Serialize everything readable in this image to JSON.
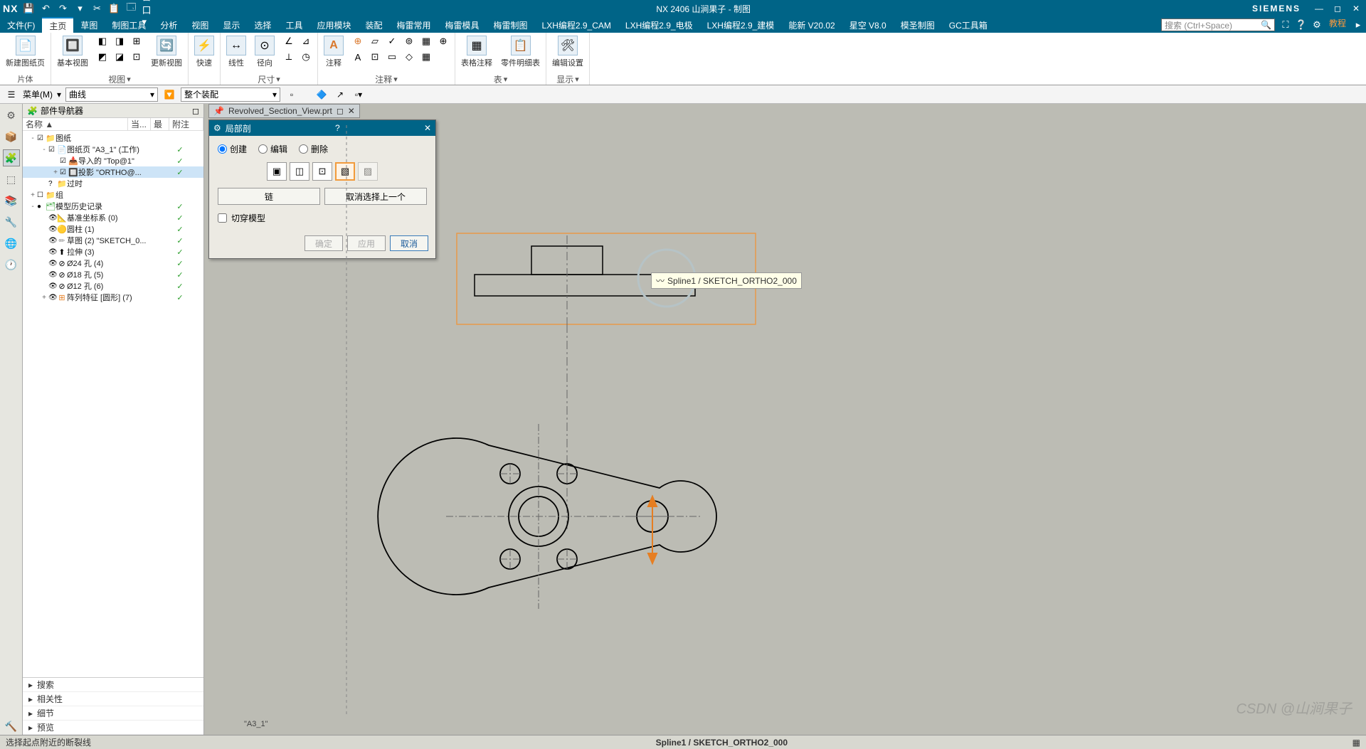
{
  "titlebar": {
    "logo": "NX",
    "title": "NX 2406 山涧果子 - 制图",
    "brand": "SIEMENS"
  },
  "menubar": {
    "items": [
      "文件(F)",
      "主页",
      "草图",
      "制图工具",
      "分析",
      "视图",
      "显示",
      "选择",
      "工具",
      "应用模块",
      "装配",
      "梅雷常用",
      "梅雷模具",
      "梅雷制图",
      "LXH编程2.9_CAM",
      "LXH编程2.9_电极",
      "LXH编程2.9_建模",
      "能新 V20.02",
      "星空 V8.0",
      "模圣制图",
      "GC工具箱"
    ],
    "activeIndex": 1,
    "searchPlaceholder": "搜索 (Ctrl+Space)",
    "tutorial": "教程"
  },
  "ribbon": {
    "groups": [
      {
        "label": "片体",
        "big": [
          {
            "lbl": "新建图纸页"
          }
        ]
      },
      {
        "label": "视图",
        "big": [
          {
            "lbl": "基本视图"
          }
        ],
        "mini2x3": true,
        "big2": [
          {
            "lbl": "更新视图"
          }
        ]
      },
      {
        "label": "",
        "big": [
          {
            "lbl": "快速"
          }
        ]
      },
      {
        "label": "尺寸",
        "big": [
          {
            "lbl": "线性"
          },
          {
            "lbl": "径向"
          }
        ],
        "mini2x2": true
      },
      {
        "label": "注释",
        "big": [
          {
            "lbl": "注释"
          }
        ],
        "annot": true
      },
      {
        "label": "",
        "sketch": true
      },
      {
        "label": "表",
        "big": [
          {
            "lbl": "表格注释"
          },
          {
            "lbl": "零件明细表"
          }
        ]
      },
      {
        "label": "显示",
        "big": [
          {
            "lbl": "编辑设置"
          }
        ]
      }
    ]
  },
  "filterbar": {
    "menu": "菜单(M)",
    "sel1": "曲线",
    "sel2": "整个装配"
  },
  "nav": {
    "title": "部件导航器",
    "cols": [
      "名称 ▲",
      "当...",
      "最",
      "附注"
    ],
    "tree": [
      {
        "ind": 0,
        "exp": "-",
        "chk": "☑",
        "ico": "📁",
        "txt": "图纸",
        "m": [
          "",
          ""
        ]
      },
      {
        "ind": 1,
        "exp": "-",
        "chk": "☑",
        "ico": "📄",
        "txt": "图纸页 \"A3_1\" (工作)",
        "m": [
          "✓",
          ""
        ]
      },
      {
        "ind": 2,
        "exp": "",
        "chk": "☑",
        "ico": "📥",
        "txt": "导入的 \"Top@1\"",
        "m": [
          "✓",
          ""
        ]
      },
      {
        "ind": 2,
        "exp": "+",
        "chk": "☑",
        "ico": "🔲",
        "txt": "投影 \"ORTHO@...",
        "m": [
          "✓",
          ""
        ],
        "sel": true
      },
      {
        "ind": 1,
        "exp": "",
        "chk": "?",
        "ico": "📁",
        "txt": "过时",
        "m": [
          "",
          ""
        ]
      },
      {
        "ind": 0,
        "exp": "+",
        "chk": "☐",
        "ico": "📁",
        "txt": "组",
        "m": [
          "",
          ""
        ]
      },
      {
        "ind": 0,
        "exp": "-",
        "chk": "●",
        "ico": "🗂",
        "txt": "模型历史记录",
        "m": [
          "✓",
          ""
        ],
        "green": true
      },
      {
        "ind": 1,
        "exp": "",
        "chk": "👁",
        "ico": "📐",
        "txt": "基准坐标系 (0)",
        "m": [
          "✓",
          ""
        ],
        "gray": true
      },
      {
        "ind": 1,
        "exp": "",
        "chk": "👁",
        "ico": "🟡",
        "txt": "圆柱 (1)",
        "m": [
          "✓",
          ""
        ]
      },
      {
        "ind": 1,
        "exp": "",
        "chk": "👁",
        "ico": "✏",
        "txt": "草图 (2) \"SKETCH_0...",
        "m": [
          "✓",
          ""
        ],
        "gray": true
      },
      {
        "ind": 1,
        "exp": "",
        "chk": "👁",
        "ico": "⬆",
        "txt": "拉伸 (3)",
        "m": [
          "✓",
          ""
        ]
      },
      {
        "ind": 1,
        "exp": "",
        "chk": "👁",
        "ico": "⊘",
        "txt": "Ø24 孔 (4)",
        "m": [
          "✓",
          ""
        ]
      },
      {
        "ind": 1,
        "exp": "",
        "chk": "👁",
        "ico": "⊘",
        "txt": "Ø18 孔 (5)",
        "m": [
          "✓",
          ""
        ]
      },
      {
        "ind": 1,
        "exp": "",
        "chk": "👁",
        "ico": "⊘",
        "txt": "Ø12 孔 (6)",
        "m": [
          "✓",
          ""
        ]
      },
      {
        "ind": 1,
        "exp": "+",
        "chk": "👁",
        "ico": "⊞",
        "txt": "阵列特征 [圆形] (7)",
        "m": [
          "✓",
          ""
        ],
        "orange": true
      }
    ],
    "footSections": [
      "搜索",
      "相关性",
      "细节",
      "预览"
    ]
  },
  "fileTab": {
    "name": "Revolved_Section_View.prt",
    "pin": "📌"
  },
  "dialog": {
    "title": "局部剖",
    "radios": [
      "创建",
      "编辑",
      "删除"
    ],
    "radioSel": 0,
    "btnChain": "链",
    "btnCancelSel": "取消选择上一个",
    "chkLabel": "切穿模型",
    "btnOk": "确定",
    "btnApply": "应用",
    "btnCancel": "取消"
  },
  "canvas": {
    "sheetLabel": "\"A3_1\"",
    "tooltip": "Spline1 / SKETCH_ORTHO2_000"
  },
  "status": {
    "left": "选择起点附近的断裂线",
    "center": "Spline1 / SKETCH_ORTHO2_000"
  },
  "watermark": "CSDN @山涧果子"
}
